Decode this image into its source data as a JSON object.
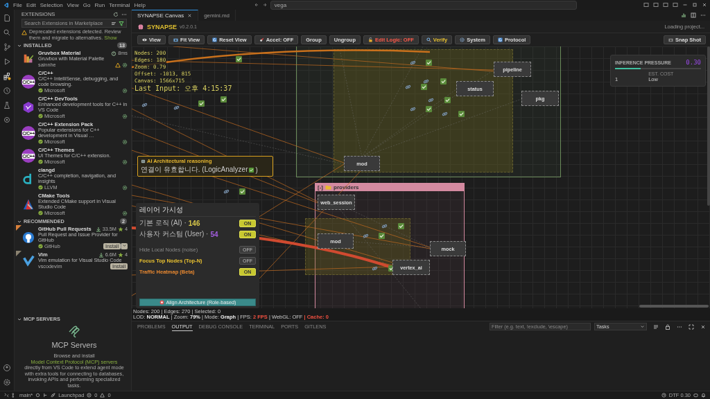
{
  "title_bar": {
    "menus": [
      "File",
      "Edit",
      "Selection",
      "View",
      "Go",
      "Run",
      "Terminal",
      "Help"
    ],
    "search": "vega"
  },
  "sidebar": {
    "title": "EXTENSIONS",
    "search": {
      "placeholder": "Search Extensions in Marketplace"
    },
    "notice": {
      "text": "Deprecated extensions detected. Review them and migrate to alternatives.",
      "link": "Show"
    },
    "installed": {
      "title": "INSTALLED",
      "count": "13",
      "expanded": true,
      "items": [
        {
          "name": "Gruvbox Material",
          "description": "Gruvbox with Material Palette",
          "publisher": "sainnhe",
          "verified": false,
          "activation_time": "8ms",
          "warning": true
        },
        {
          "name": "C/C++",
          "description": "C/C++ IntelliSense, debugging, and code browsing.",
          "publisher": "Microsoft",
          "verified": true,
          "badge_text": "C/C++",
          "warning": false
        },
        {
          "name": "C/C++ DevTools",
          "description": "Enhanced development tools for C++ in VS Code",
          "publisher": "Microsoft",
          "verified": true,
          "warning": false
        },
        {
          "name": "C/C++ Extension Pack",
          "description": "Popular extensions for C++ development in Visual …",
          "publisher": "Microsoft",
          "verified": true,
          "badge_text": "C/C++",
          "warning": false
        },
        {
          "name": "C/C++ Themes",
          "description": "UI Themes for C/C++ extension.",
          "publisher": "Microsoft",
          "verified": true,
          "badge_text": "C/C++",
          "warning": false
        },
        {
          "name": "clangd",
          "description": "C/C++ completion, navigation, and insights",
          "publisher": "LLVM",
          "verified": true,
          "warning": false
        },
        {
          "name": "CMake Tools",
          "description": "Extended CMake support in Visual Studio Code",
          "publisher": "Microsoft",
          "verified": true,
          "warning": false
        }
      ]
    },
    "recommended": {
      "title": "RECOMMENDED",
      "count": "2",
      "expanded": true,
      "items": [
        {
          "name": "GitHub Pull Requests",
          "description": "Pull Request and Issue Provider for GitHub",
          "publisher": "GitHub",
          "verified": true,
          "downloads": "33.5M",
          "rating": "4",
          "install": "Install",
          "split": true
        },
        {
          "name": "Vim",
          "description": "Vim emulation for Visual Studio Code",
          "publisher": "vscodevim",
          "verified": false,
          "downloads": "6.6M",
          "rating": "4",
          "install": "Install",
          "split": false
        }
      ]
    },
    "mcp": {
      "title": "MCP SERVERS",
      "expanded": true,
      "heading": "MCP Servers",
      "text_before": "Browse and install",
      "link": "Model Context Protocol (MCP) servers",
      "text_after": "directly from VS Code to extend agent mode with extra tools for connecting to databases, invoking APIs and performing specialized tasks."
    }
  },
  "tabs": [
    {
      "label": "SYNAPSE Canvas",
      "selected": true
    },
    {
      "label": "gemini.md",
      "selected": false
    }
  ],
  "synapse": {
    "title": "SYNAPSE",
    "version": "v0.2.0.1",
    "status": "Loading project...",
    "toolbar": [
      {
        "label": "View",
        "kind": "normal"
      },
      {
        "label": "Fit View",
        "kind": "normal"
      },
      {
        "label": "Reset View",
        "kind": "normal"
      },
      {
        "label": "Accel: OFF",
        "kind": "normal"
      },
      {
        "label": "Group",
        "kind": "normal"
      },
      {
        "label": "Ungroup",
        "kind": "normal"
      },
      {
        "label": "Edit Logic: OFF",
        "kind": "danger"
      },
      {
        "label": "Verify",
        "kind": "warn"
      },
      {
        "label": "System",
        "kind": "normal"
      },
      {
        "label": "Protocol",
        "kind": "normal"
      }
    ],
    "snapshot": "Snap Shot",
    "debug": [
      "Nodes: 200",
      "Edges: 180",
      "Zoom: 0.79",
      "Offset: -1013, 815",
      "Canvas: 1566x715",
      "Last Input: 오후 4:15:37"
    ],
    "group_label": "providers",
    "group_toggle": "[-]",
    "nodes": [
      "pipeline",
      "status",
      "pkg",
      "mod",
      "web_session",
      "mod",
      "mock",
      "vertex_ai"
    ],
    "tooltip": {
      "title": "AI Architectural reasoning",
      "text": "연결이 유효합니다. (LogicAnalyzer",
      "text_end": ")"
    },
    "layers": {
      "title": "레이어 가시성",
      "rows": [
        {
          "label": "기본 로직 (AI) · ",
          "count": "146",
          "color": "#d8c84a",
          "kind": "plain",
          "on": true,
          "state_text": "ON"
        },
        {
          "label": "사용자 커스텀 (User) · ",
          "count": "54",
          "color": "#a45ee0",
          "kind": "plain",
          "on": true,
          "state_text": "ON"
        },
        {
          "label": "Hide Local Nodes (noise)",
          "kind": "muted",
          "on": false,
          "state_text": "OFF"
        },
        {
          "label": "Focus Top Nodes (Top-N)",
          "kind": "focus",
          "on": false,
          "state_text": "OFF"
        },
        {
          "label": "Traffic Heatmap (Beta)",
          "kind": "heat",
          "on": true,
          "state_text": "ON"
        }
      ],
      "align_button": "Align Architecture (Role-based)"
    },
    "pressure": {
      "title": "INFERENCE PRESSURE",
      "value": "0.30",
      "level": 0.3,
      "stat_value": "1",
      "cost_label": "EST. COST",
      "cost_value": "Low"
    },
    "stats_line": "Nodes: 200 | Edges: 270 | Selected: 0",
    "render_stats": [
      {
        "text": "LOD: ",
        "kind": "plain"
      },
      {
        "text": "NORMAL",
        "kind": "bold"
      },
      {
        "text": " | Zoom: ",
        "kind": "plain"
      },
      {
        "text": "79%",
        "kind": "bold"
      },
      {
        "text": " | Mode: ",
        "kind": "plain"
      },
      {
        "text": "Graph",
        "kind": "bold"
      },
      {
        "text": " | FPS: ",
        "kind": "plain"
      },
      {
        "text": "2 FPS",
        "kind": "alert"
      },
      {
        "text": " | WebGL: OFF ",
        "kind": "plain"
      },
      {
        "text": "| Cache: 0",
        "kind": "alert"
      }
    ]
  },
  "panel": {
    "tabs": [
      {
        "label": "PROBLEMS",
        "selected": false
      },
      {
        "label": "OUTPUT",
        "selected": true
      },
      {
        "label": "DEBUG CONSOLE",
        "selected": false
      },
      {
        "label": "TERMINAL",
        "selected": false
      },
      {
        "label": "PORTS",
        "selected": false
      },
      {
        "label": "GITLENS",
        "selected": false
      }
    ],
    "filter": {
      "placeholder": "Filter (e.g. text, !exclude, \\escape)"
    },
    "channel": "Tasks"
  },
  "status_bar": {
    "branch": "main*",
    "launchpad": "Launchpad",
    "errors": "0",
    "warnings": "0",
    "right": "DTF 0.30"
  }
}
